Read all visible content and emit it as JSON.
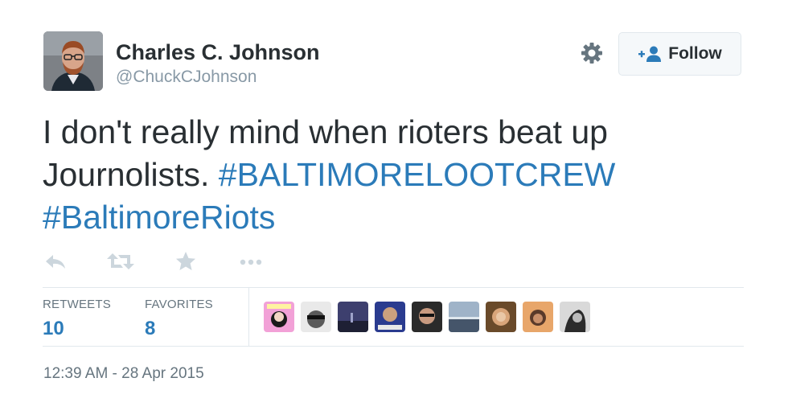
{
  "author": {
    "name": "Charles C. Johnson",
    "handle": "@ChuckCJohnson"
  },
  "follow_button": {
    "label": "Follow"
  },
  "tweet": {
    "text_plain": "I don't really mind when rioters beat up Journolists.",
    "hashtag_1": "#BALTIMORELOOTCREW",
    "hashtag_2": "#BaltimoreRiots"
  },
  "actions": [
    "reply-icon",
    "retweet-icon",
    "favorite-icon",
    "more-icon"
  ],
  "stats": {
    "retweets_label": "RETWEETS",
    "retweets_value": "10",
    "favorites_label": "FAVORITES",
    "favorites_value": "8"
  },
  "timestamp": "12:39 AM - 28 Apr 2015",
  "colors": {
    "link": "#2b7bb9",
    "text": "#292f33",
    "muted": "#8899a6",
    "icon": "#ccd6dd"
  }
}
